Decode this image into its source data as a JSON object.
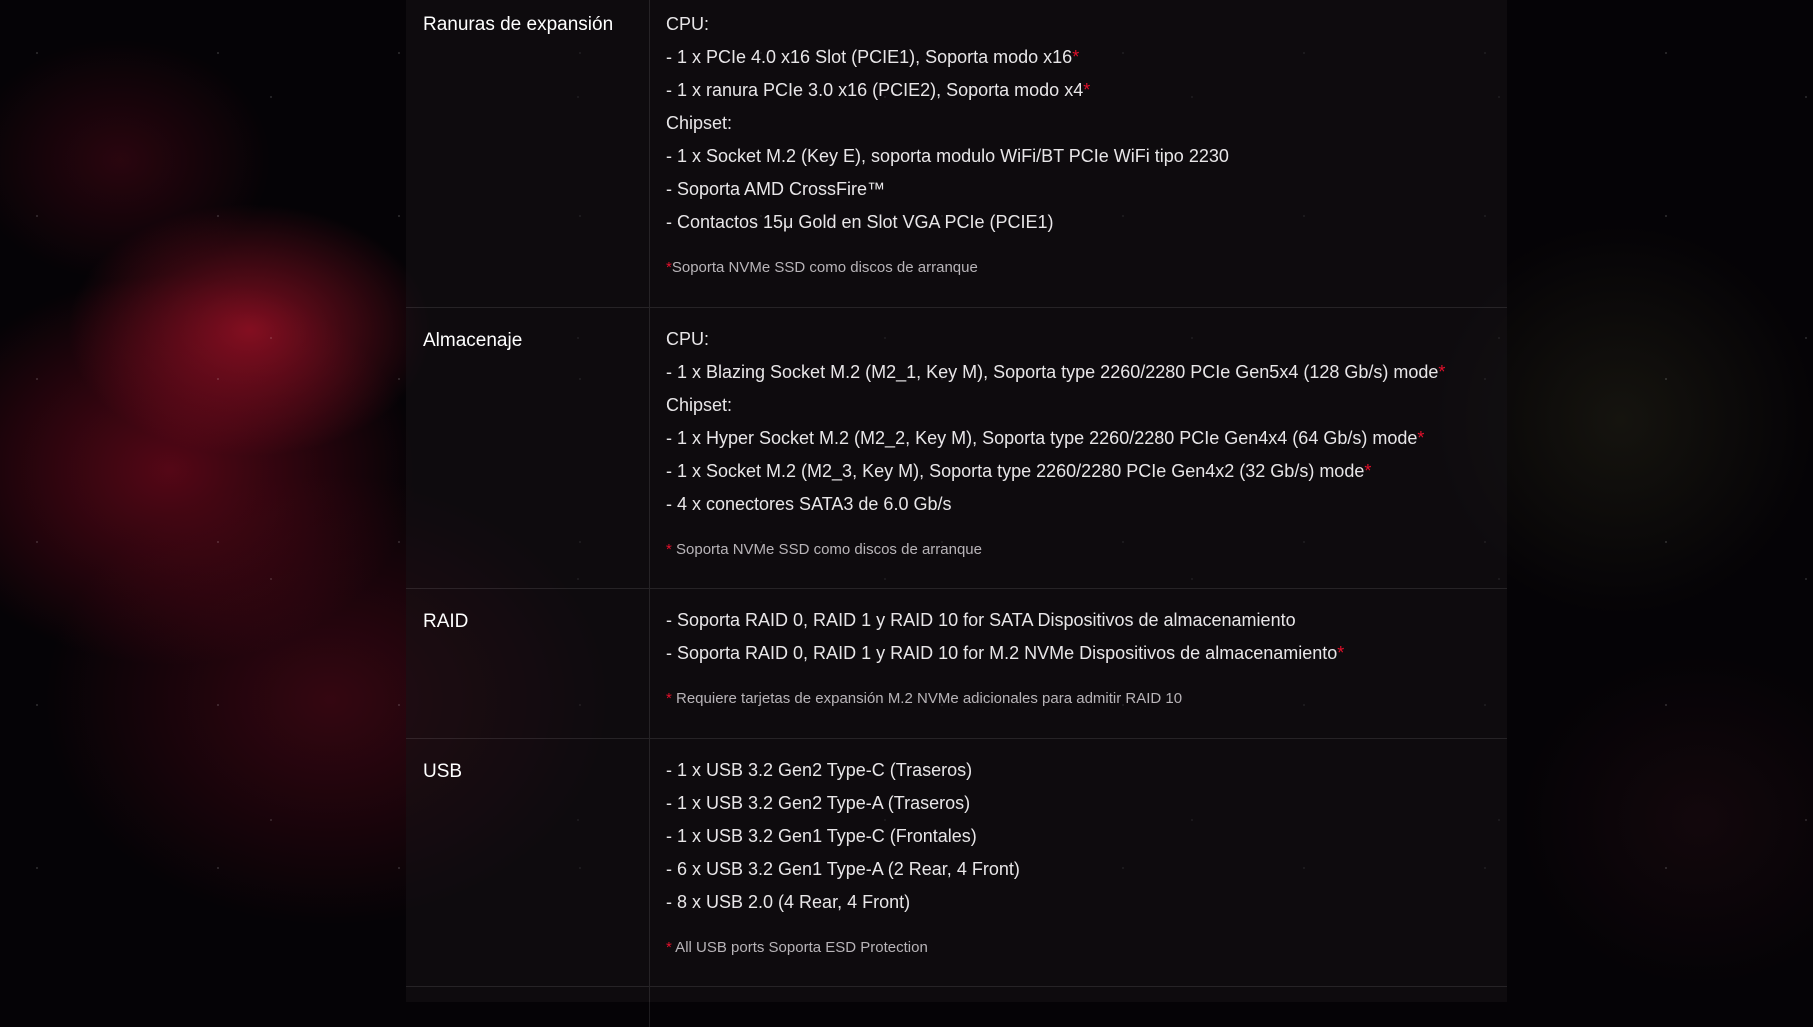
{
  "accent_color": "#e2102b",
  "specs": [
    {
      "label": "Ranuras de expansión",
      "lines": [
        "CPU:",
        "- 1 x PCIe 4.0 x16 Slot (PCIE1), Soporta modo x16",
        "- 1 x ranura PCIe 3.0 x16 (PCIE2), Soporta modo x4",
        "Chipset:",
        "- 1 x Socket M.2 (Key E), soporta modulo WiFi/BT PCIe WiFi tipo 2230",
        "- Soporta AMD CrossFire™",
        "- Contactos 15μ Gold en Slot VGA PCIe (PCIE1)"
      ],
      "note_marker": "*",
      "note": "Soporta NVMe SSD como discos de arranque"
    },
    {
      "label": "Almacenaje",
      "lines": [
        "CPU:",
        "- 1 x Blazing Socket M.2 (M2_1, Key M), Soporta type 2260/2280 PCIe Gen5x4 (128 Gb/s) mode",
        "Chipset:",
        "- 1 x Hyper Socket M.2 (M2_2, Key M), Soporta type 2260/2280 PCIe Gen4x4 (64 Gb/s) mode",
        "- 1 x Socket M.2 (M2_3, Key M), Soporta type 2260/2280 PCIe Gen4x2 (32 Gb/s) mode",
        "- 4 x conectores SATA3 de 6.0 Gb/s"
      ],
      "note_marker": "*",
      "note": " Soporta NVMe SSD como discos de arranque"
    },
    {
      "label": "RAID",
      "lines": [
        "- Soporta RAID 0, RAID 1 y RAID 10 for SATA Dispositivos de almacenamiento",
        "- Soporta RAID 0, RAID 1 y RAID 10 for M.2 NVMe Dispositivos de almacenamiento"
      ],
      "note_marker": "*",
      "note": " Requiere tarjetas de expansión M.2 NVMe adicionales para admitir RAID 10"
    },
    {
      "label": "USB",
      "lines": [
        "- 1 x USB 3.2 Gen2 Type-C (Traseros)",
        "- 1 x USB 3.2 Gen2 Type-A (Traseros)",
        "- 1 x USB 3.2 Gen1 Type-C (Frontales)",
        "- 6 x USB 3.2 Gen1 Type-A (2 Rear, 4 Front)",
        "- 8 x USB 2.0 (4 Rear, 4 Front)"
      ],
      "note_marker": "*",
      "note": " All USB ports Soporta ESD Protection"
    }
  ]
}
